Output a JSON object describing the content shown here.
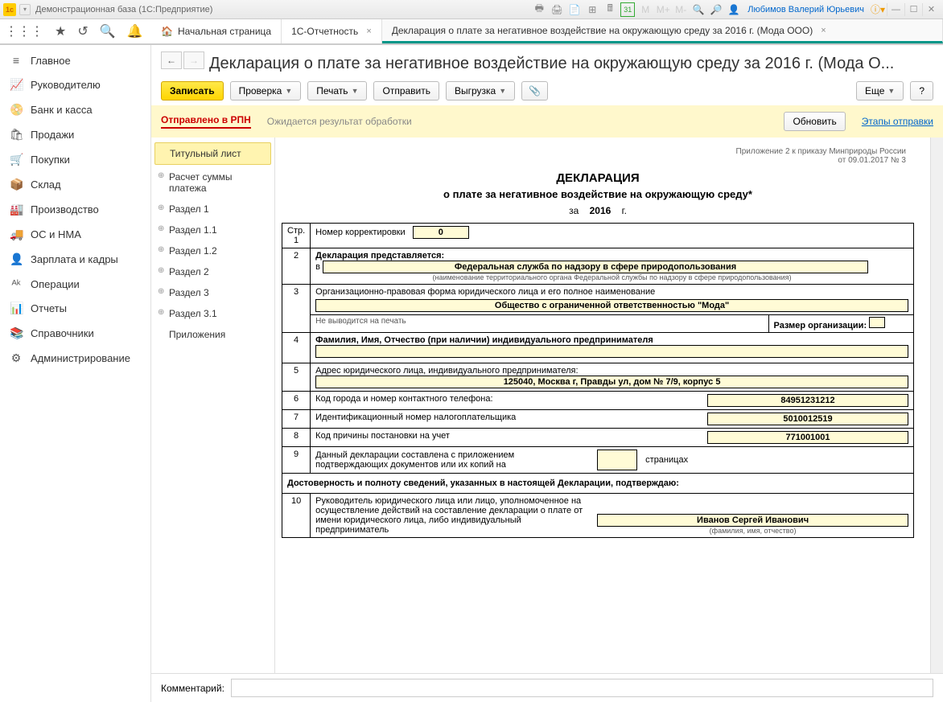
{
  "titlebar": {
    "app_title": "Демонстрационная база  (1С:Предприятие)",
    "user_name": "Любимов Валерий Юрьевич",
    "calendar_day": "31"
  },
  "tabs": {
    "home": "Начальная страница",
    "reporting": "1С-Отчетность",
    "doc": "Декларация о плате за негативное воздействие на окружающую среду за 2016 г. (Мода ООО)"
  },
  "sidebar": [
    {
      "icon": "≡",
      "label": "Главное"
    },
    {
      "icon": "📈",
      "label": "Руководителю"
    },
    {
      "icon": "📀",
      "label": "Банк и касса"
    },
    {
      "icon": "🛍",
      "label": "Продажи"
    },
    {
      "icon": "🛒",
      "label": "Покупки"
    },
    {
      "icon": "📦",
      "label": "Склад"
    },
    {
      "icon": "🏭",
      "label": "Производство"
    },
    {
      "icon": "🚚",
      "label": "ОС и НМА"
    },
    {
      "icon": "👤",
      "label": "Зарплата и кадры"
    },
    {
      "icon": "ᴬᵏ",
      "label": "Операции"
    },
    {
      "icon": "📊",
      "label": "Отчеты"
    },
    {
      "icon": "📚",
      "label": "Справочники"
    },
    {
      "icon": "⚙",
      "label": "Администрирование"
    }
  ],
  "doc": {
    "title": "Декларация о плате за негативное воздействие на окружающую среду за 2016 г. (Мода О...",
    "btn_save": "Записать",
    "btn_check": "Проверка",
    "btn_print": "Печать",
    "btn_send": "Отправить",
    "btn_export": "Выгрузка",
    "btn_more": "Еще",
    "status_sent": "Отправлено в РПН",
    "status_wait": "Ожидается результат обработки",
    "btn_refresh": "Обновить",
    "link_stages": "Этапы отправки"
  },
  "sections": [
    "Титульный лист",
    "Расчет суммы платежа",
    "Раздел 1",
    "Раздел 1.1",
    "Раздел 1.2",
    "Раздел 2",
    "Раздел 3",
    "Раздел 3.1",
    "Приложения"
  ],
  "form": {
    "appendix_note1": "Приложение 2 к приказу Минприроды России",
    "appendix_note2": "от 09.01.2017 № 3",
    "title": "ДЕКЛАРАЦИЯ",
    "subtitle": "о плате за негативное воздействие на окружающую среду*",
    "year_prefix": "за",
    "year": "2016",
    "year_suffix": "г.",
    "col_page": "Стр.",
    "col_page_num": "1",
    "row1_label": "Номер корректировки",
    "row1_value": "0",
    "row2_num": "2",
    "row2_title": "Декларация представляется:",
    "row2_prefix": "в",
    "row2_value": "Федеральная служба по надзору в сфере природопользования",
    "row2_note": "(наименование территориального органа Федеральной службы по надзору в сфере природопользования)",
    "row3_num": "3",
    "row3_label": "Организационно-правовая форма юридического лица и его полное наименование",
    "row3_value": "Общество с ограниченной ответственностью \"Мода\"",
    "row3_note": "Не выводится на печать",
    "row3_right": "Размер организации:",
    "row4_num": "4",
    "row4_label": "Фамилия, Имя, Отчество (при наличии) индивидуального предпринимателя",
    "row5_num": "5",
    "row5_label": "Адрес юридического лица, индивидуального предпринимателя:",
    "row5_value": "125040, Москва г, Правды ул, дом № 7/9, корпус 5",
    "row6_num": "6",
    "row6_label": "Код города и номер контактного телефона:",
    "row6_value": "84951231212",
    "row7_num": "7",
    "row7_label": "Идентификационный номер налогоплательщика",
    "row7_value": "5010012519",
    "row8_num": "8",
    "row8_label": "Код причины постановки на учет",
    "row8_value": "771001001",
    "row9_num": "9",
    "row9_label": "Данный декларации составлена с приложением подтверждающих документов или их копий на",
    "row9_suffix": "страницах",
    "row10_title": "Достоверность и полноту сведений, указанных в настоящей Декларации, подтверждаю:",
    "row10_num": "10",
    "row10_label": "Руководитель юридического лица или лицо, уполномоченное на осуществление действий на составление декларации о плате от имени юридического лица, либо индивидуальный предприниматель",
    "row10_value": "Иванов Сергей Иванович",
    "row10_note": "(фамилия, имя, отчество)"
  },
  "footer": {
    "label": "Комментарий:"
  }
}
